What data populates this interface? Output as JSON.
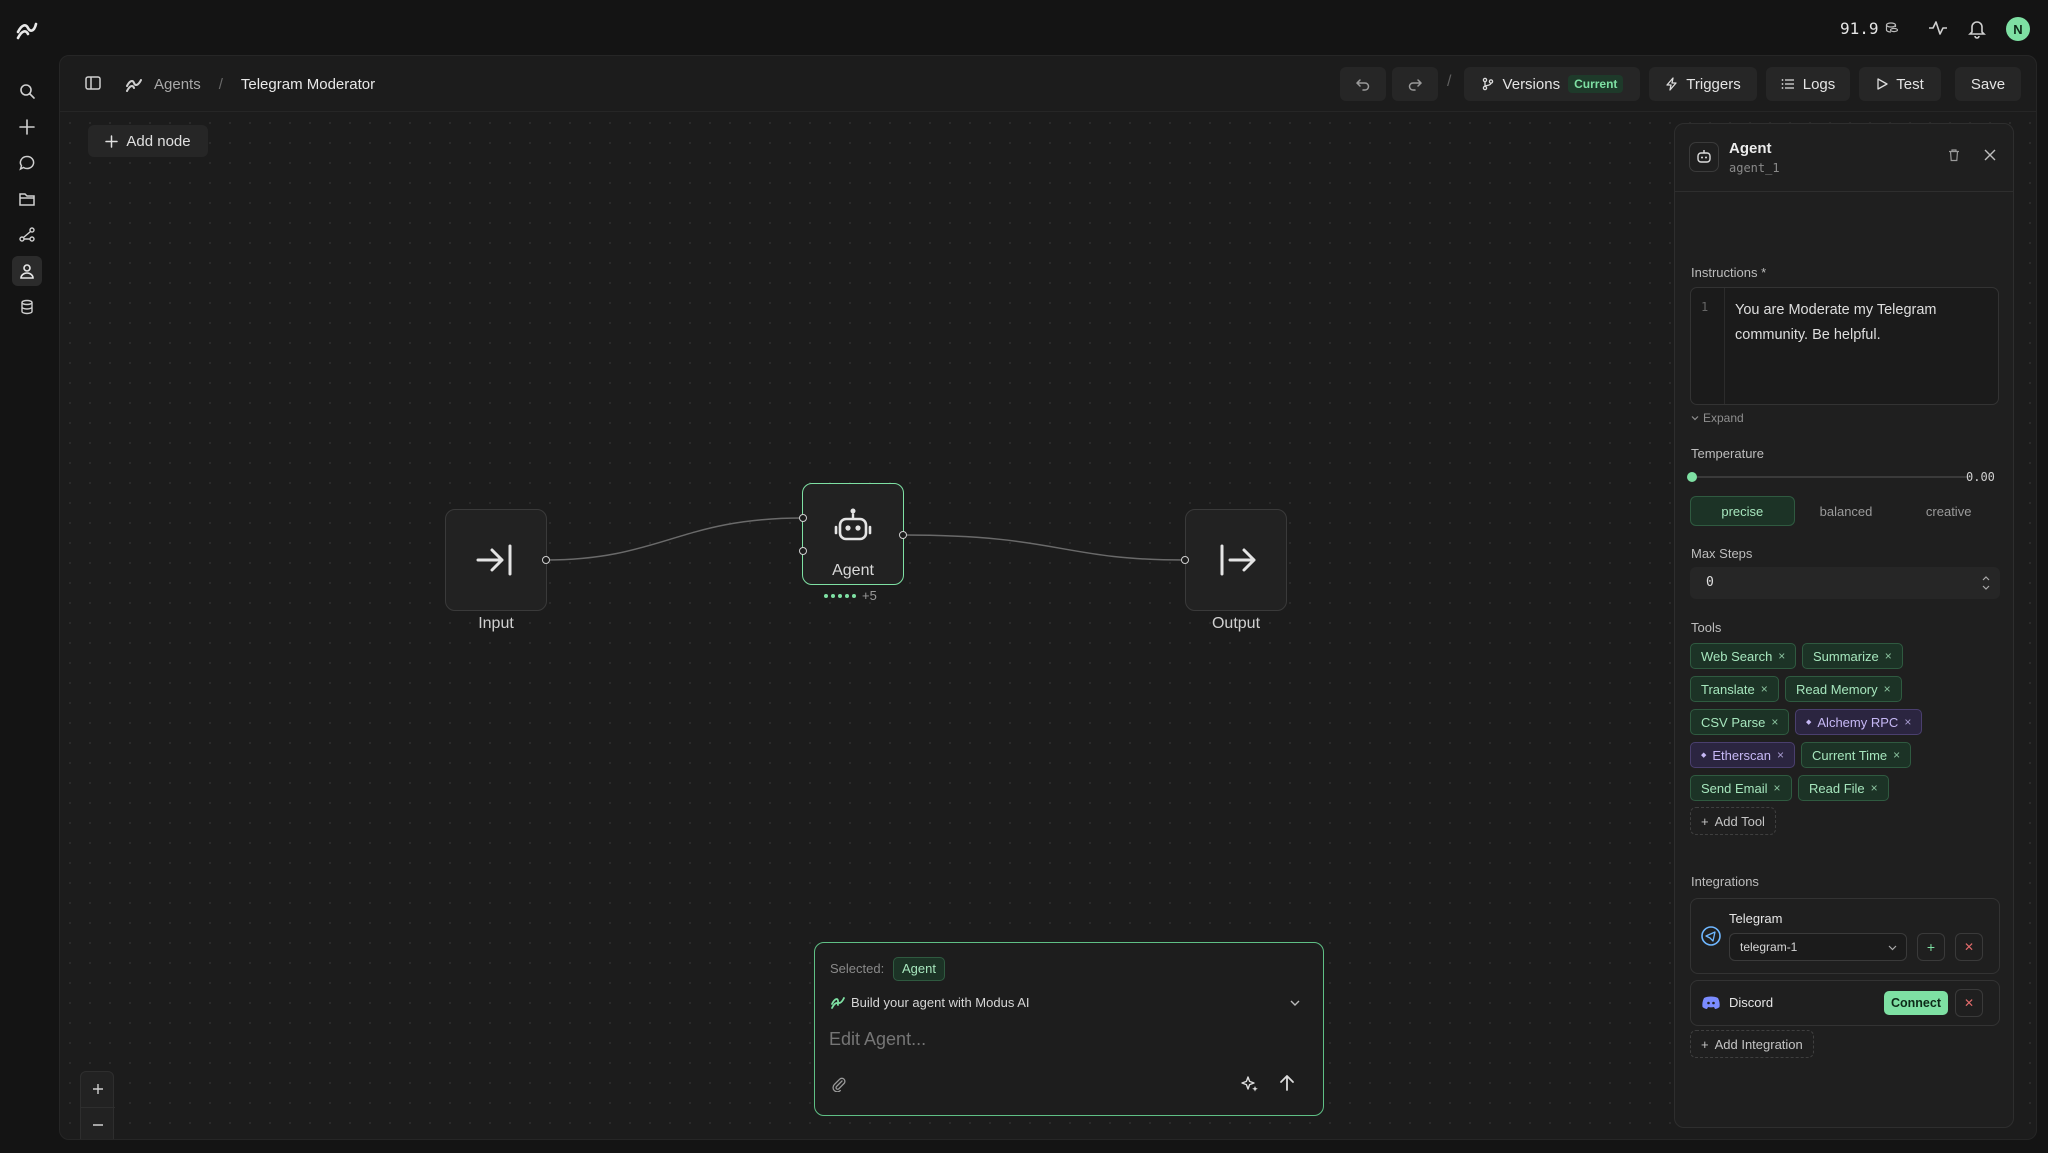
{
  "topbar": {
    "credits": "91.9"
  },
  "avatar": {
    "initial": "N"
  },
  "header": {
    "breadcrumb_parent": "Agents",
    "breadcrumb_separator": "/",
    "title": "Telegram Moderator",
    "path_separator": "/",
    "versions_label": "Versions",
    "versions_badge": "Current",
    "triggers_label": "Triggers",
    "logs_label": "Logs",
    "test_label": "Test",
    "save_label": "Save"
  },
  "canvas": {
    "add_node_label": "Add node",
    "nodes": {
      "input_label": "Input",
      "agent_label": "Agent",
      "agent_extra": "+5",
      "output_label": "Output"
    }
  },
  "panel": {
    "title": "Agent",
    "id": "agent_1",
    "instructions_label": "Instructions",
    "required_mark": "*",
    "line_number": "1",
    "instructions_text": "You are Moderate my Telegram community. Be helpful.",
    "expand_label": "Expand",
    "temperature_label": "Temperature",
    "temperature_value": "0.00",
    "temperature_fraction": 0,
    "presets": [
      "precise",
      "balanced",
      "creative"
    ],
    "max_steps_label": "Max Steps",
    "max_steps_value": "0",
    "tools_label": "Tools",
    "tools": [
      {
        "label": "Web Search",
        "style": "green"
      },
      {
        "label": "Summarize",
        "style": "green"
      },
      {
        "label": "Translate",
        "style": "green"
      },
      {
        "label": "Read Memory",
        "style": "green"
      },
      {
        "label": "CSV Parse",
        "style": "green"
      },
      {
        "label": "Alchemy RPC",
        "style": "purple"
      },
      {
        "label": "Etherscan",
        "style": "purple"
      },
      {
        "label": "Current Time",
        "style": "green"
      },
      {
        "label": "Send Email",
        "style": "green"
      },
      {
        "label": "Read File",
        "style": "green"
      }
    ],
    "add_tool_label": "Add Tool",
    "integrations_label": "Integrations",
    "telegram_name": "Telegram",
    "telegram_select_value": "telegram-1",
    "discord_name": "Discord",
    "connect_label": "Connect",
    "add_integration_label": "Add Integration"
  },
  "chat": {
    "selected_label": "Selected:",
    "selected_value": "Agent",
    "build_label": "Build your agent with Modus AI",
    "input_placeholder": "Edit Agent..."
  },
  "colors": {
    "accent_green": "#7ee0a3",
    "chip_purple": "#c6b8f5",
    "background": "#141414"
  }
}
